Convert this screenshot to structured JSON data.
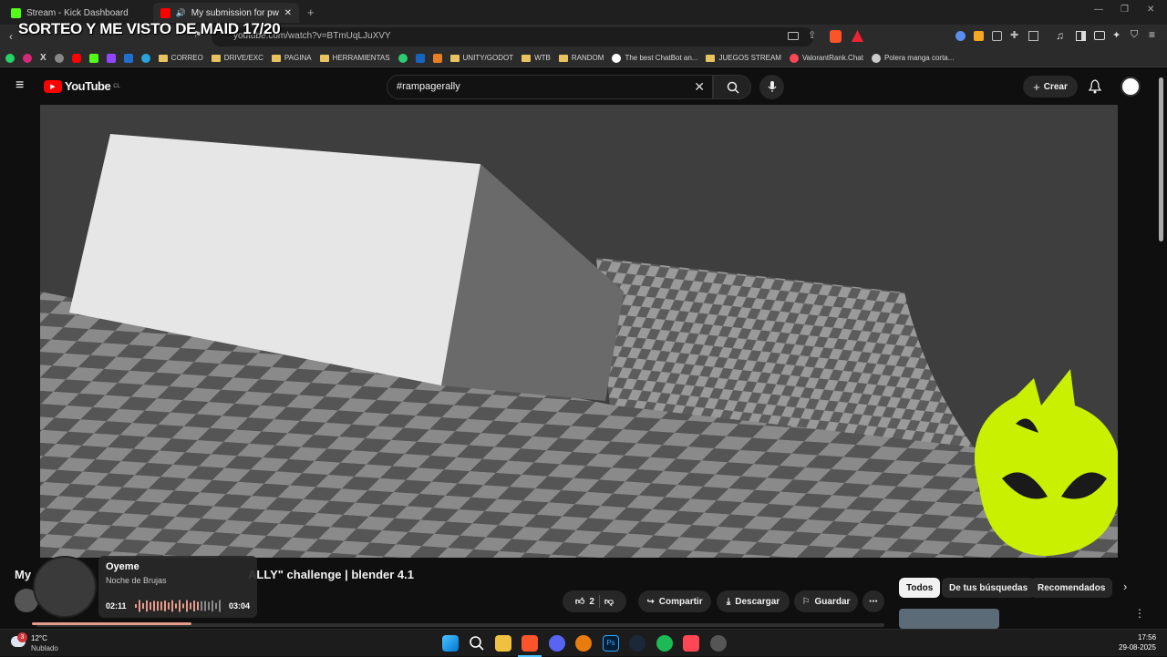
{
  "browser": {
    "tabs": [
      {
        "title": "Stream - Kick Dashboard"
      },
      {
        "title": "My submission for pwnisher"
      }
    ],
    "url": "youtube.com/watch?v=BTmUqLJuXVY",
    "bookmarks": [
      "CORREO",
      "DRIVE/EXC",
      "PAGINA",
      "HERRAMIENTAS",
      "UNITY/GODOT",
      "WTB",
      "RANDOM",
      "The best ChatBot an...",
      "JUEGOS STREAM",
      "ValorantRank.Chat",
      "Polera manga corta..."
    ]
  },
  "overlay": {
    "title": "SORTEO Y ME VISTO DE MAID 17/20"
  },
  "youtube": {
    "logo": "YouTube",
    "region": "CL",
    "search_value": "#rampagerally",
    "create_label": "Crear",
    "video_title_start": "My",
    "video_title_end": "ALLY\" challenge | blender 4.1",
    "likes": "2",
    "share_label": "Compartir",
    "download_label": "Descargar",
    "save_label": "Guardar",
    "chips": [
      "Todos",
      "De tus búsquedas",
      "Recomendados"
    ]
  },
  "music_widget": {
    "song": "Oyeme",
    "artist": "Noche de Brujas",
    "elapsed": "02:11",
    "duration": "03:04",
    "progress": 0.71
  },
  "taskbar": {
    "weather_temp": "12°C",
    "weather_desc": "Nublado",
    "notification_count": "3",
    "time": "17:56",
    "date": "29-08-2025"
  },
  "colors": {
    "accent_red": "#ff0000",
    "mascot_green": "#c8f000",
    "checker_light": "#8a8a8a",
    "checker_dark": "#555555"
  }
}
